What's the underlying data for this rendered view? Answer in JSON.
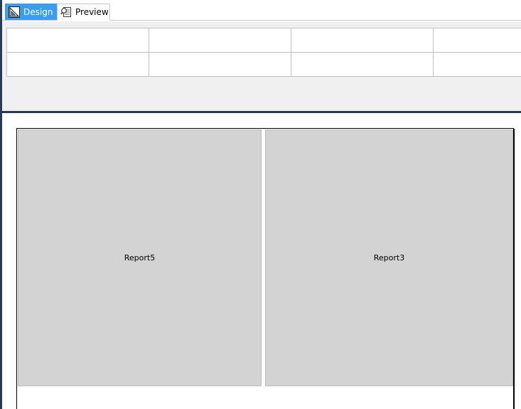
{
  "tabs": [
    {
      "label": "Design",
      "icon": "design-ruler-icon",
      "active": true
    },
    {
      "label": "Preview",
      "icon": "preview-report-icon",
      "active": false
    }
  ],
  "parameter_grid": {
    "rows": 2,
    "columns": 4,
    "cells": [
      [
        "",
        "",
        "",
        ""
      ],
      [
        "",
        "",
        "",
        ""
      ]
    ]
  },
  "report": {
    "subreports": [
      {
        "label": "Report5"
      },
      {
        "label": "Report3"
      }
    ]
  },
  "colors": {
    "active_tab": "#3c9cf0",
    "subreport_fill": "#d3d3d3",
    "param_area_bg": "#f0f0f0",
    "frame_border": "#2b3a55"
  }
}
